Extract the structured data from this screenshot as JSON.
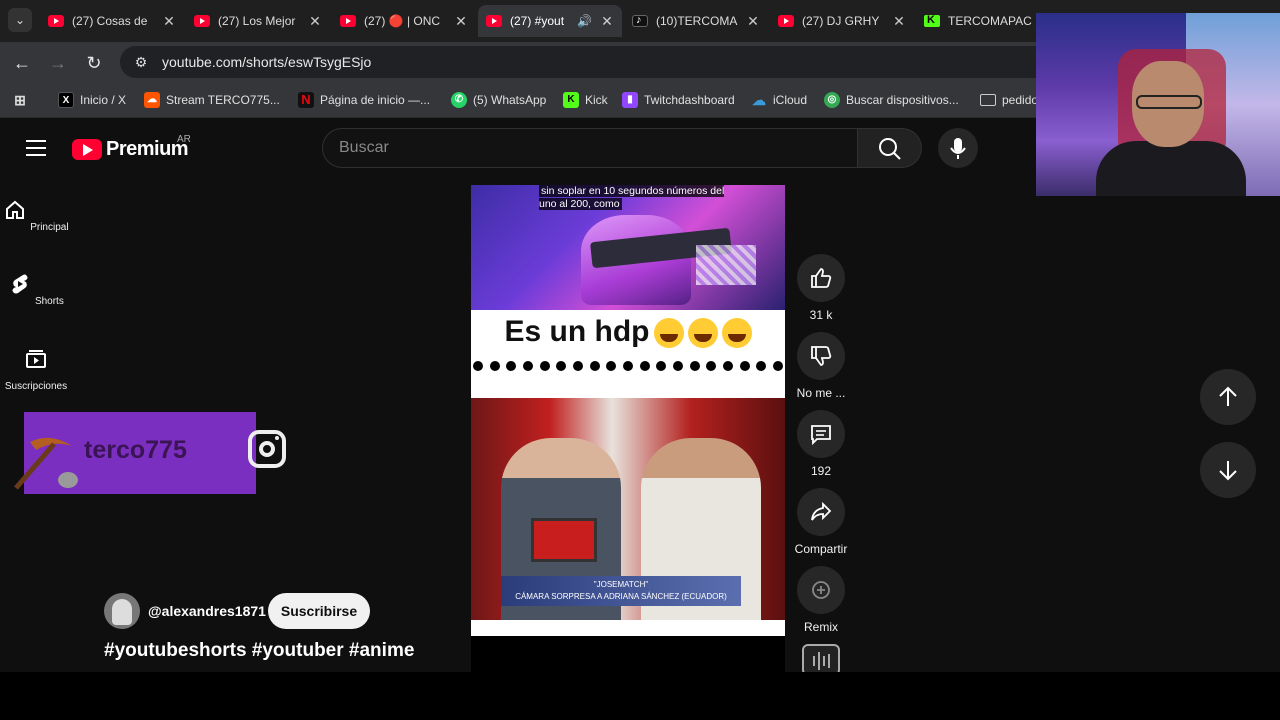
{
  "browser": {
    "tabs": [
      {
        "title": "(27) Cosas de",
        "icon": "youtube-icon",
        "active": false
      },
      {
        "title": "(27) Los Mejor",
        "icon": "youtube-icon",
        "active": false
      },
      {
        "title": "(27) 🔴 | ONC",
        "icon": "youtube-icon",
        "active": false
      },
      {
        "title": "(27) #yout",
        "icon": "youtube-icon",
        "active": true,
        "audio": true
      },
      {
        "title": "(10)TERCOMA",
        "icon": "tiktok-icon",
        "active": false
      },
      {
        "title": "(27) DJ GRHY",
        "icon": "youtube-icon",
        "active": false
      },
      {
        "title": "TERCOMAPAC",
        "icon": "kick-icon",
        "active": false
      }
    ],
    "url": "youtube.com/shorts/eswTsygESjo",
    "bookmarks": [
      {
        "label": "Inicio / X",
        "icon": "x-icon",
        "color": "#000000"
      },
      {
        "label": "Stream TERCO775...",
        "icon": "soundcloud-icon",
        "color": "#ff5500"
      },
      {
        "label": "Página de inicio —...",
        "icon": "netflix-icon",
        "color": "#e50914"
      },
      {
        "label": "(5) WhatsApp",
        "icon": "whatsapp-icon",
        "color": "#25d366"
      },
      {
        "label": "Kick",
        "icon": "kick-icon",
        "color": "#53fc18"
      },
      {
        "label": "Twitchdashboard",
        "icon": "twitch-icon",
        "color": "#9146ff"
      },
      {
        "label": "iCloud",
        "icon": "icloud-icon",
        "color": "#3a9bdc"
      },
      {
        "label": "Buscar dispositivos...",
        "icon": "find-device-icon",
        "color": "#34a853"
      },
      {
        "label": "pedido",
        "icon": "folder-icon",
        "color": "#bbbbbb"
      }
    ]
  },
  "youtube": {
    "brand": {
      "word": "Premium",
      "region": "AR",
      "accent": "#ff0033"
    },
    "search": {
      "placeholder": "Buscar"
    },
    "guide": [
      {
        "label": "Principal",
        "icon": "home-icon"
      },
      {
        "label": "Shorts",
        "icon": "shorts-icon"
      },
      {
        "label": "Suscripciones",
        "icon": "subscriptions-icon"
      }
    ],
    "overlay": {
      "text": "terco775"
    },
    "short": {
      "subtitle": "sin soplar en 10 segundos números del uno al 200, como",
      "caption": "Es un hdp",
      "lower_third_name": "\"JOSEMATCH\"",
      "lower_third_text": "CÁMARA SORPRESA A ADRIANA SÁNCHEZ (ECUADOR)",
      "channel": "@alexandres1871",
      "subscribe_label": "Suscribirse",
      "hashtags": "#youtubeshorts #youtuber #anime"
    },
    "actions": {
      "like_count": "31 k",
      "dislike_label": "No me ...",
      "comments_count": "192",
      "share_label": "Compartir",
      "remix_label": "Remix"
    }
  }
}
